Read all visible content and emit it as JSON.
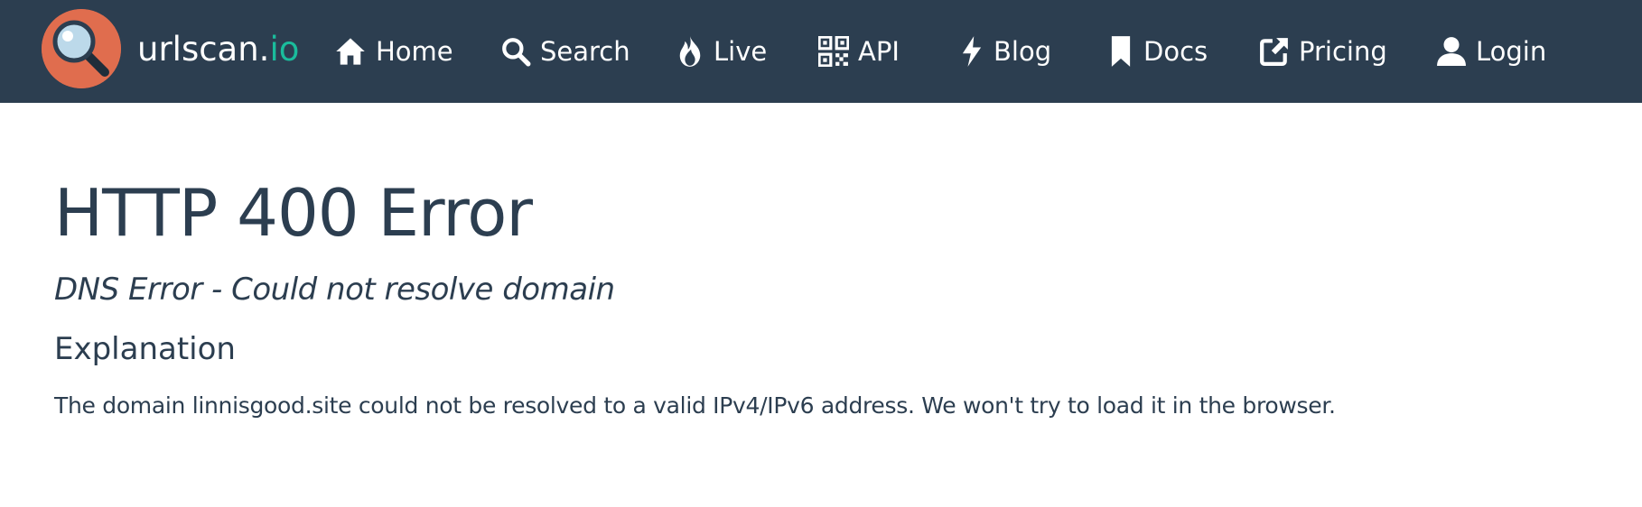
{
  "brand": {
    "name_main": "urlscan.",
    "name_accent": "io",
    "logo_icon": "magnifier-icon",
    "logo_color": "#e06d4e",
    "accent_color": "#1abc9c"
  },
  "nav": {
    "background": "#2c3e50",
    "items": [
      {
        "label": "Home",
        "icon": "home-icon"
      },
      {
        "label": "Search",
        "icon": "search-icon"
      },
      {
        "label": "Live",
        "icon": "fire-icon"
      },
      {
        "label": "API",
        "icon": "qrcode-icon"
      },
      {
        "label": "Blog",
        "icon": "bolt-icon"
      },
      {
        "label": "Docs",
        "icon": "bookmark-icon"
      },
      {
        "label": "Pricing",
        "icon": "external-link-icon"
      },
      {
        "label": "Login",
        "icon": "user-icon"
      }
    ]
  },
  "error": {
    "title": "HTTP 400 Error",
    "subtitle": "DNS Error - Could not resolve domain",
    "section_heading": "Explanation",
    "explanation": "The domain linnisgood.site could not be resolved to a valid IPv4/IPv6 address. We won't try to load it in the browser."
  }
}
